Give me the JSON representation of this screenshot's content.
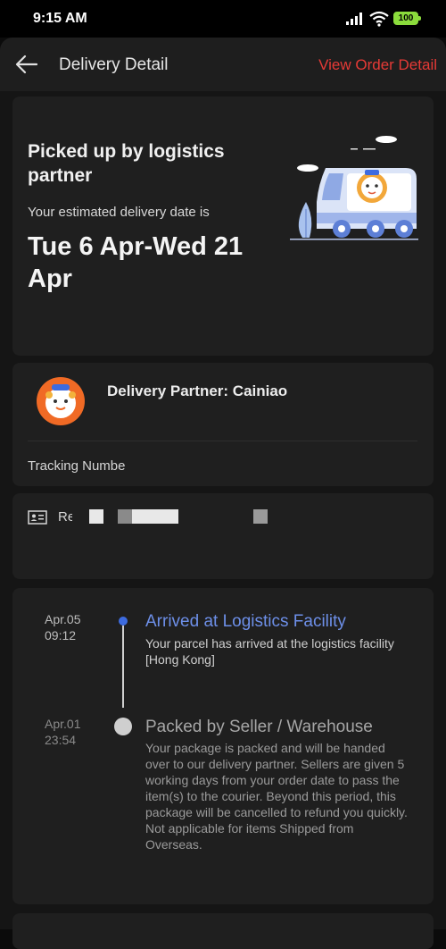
{
  "status_bar": {
    "time": "9:15 AM",
    "battery": "100"
  },
  "header": {
    "title": "Delivery Detail",
    "view_order_link": "View Order Detail"
  },
  "hero": {
    "status_title": "Picked up by logistics partner",
    "estimate_label": "Your estimated delivery date is",
    "estimate_date": "Tue 6 Apr-Wed 21 Apr"
  },
  "partner": {
    "label": "Delivery Partner: Cainiao",
    "tracking_label": "Tracking Numbe"
  },
  "receiver": {
    "label": "Re"
  },
  "timeline": [
    {
      "date": "Apr.05",
      "time": "09:12",
      "title": "Arrived at Logistics Facility",
      "description": "Your parcel has arrived at the logistics facility [Hong Kong]",
      "state": "active"
    },
    {
      "date": "Apr.01",
      "time": "23:54",
      "title": "Packed by Seller / Warehouse",
      "description": "Your package is packed and will be handed over to our delivery partner. Sellers are given 5 working days from your order date to pass the item(s) to the courier. Beyond this period, this package will be cancelled to refund you quickly. Not applicable for items Shipped from Overseas.",
      "state": "done"
    }
  ],
  "colors": {
    "accent_red": "#e63a36",
    "active_blue": "#6d8fe8",
    "battery_green": "#8bdc3c"
  }
}
